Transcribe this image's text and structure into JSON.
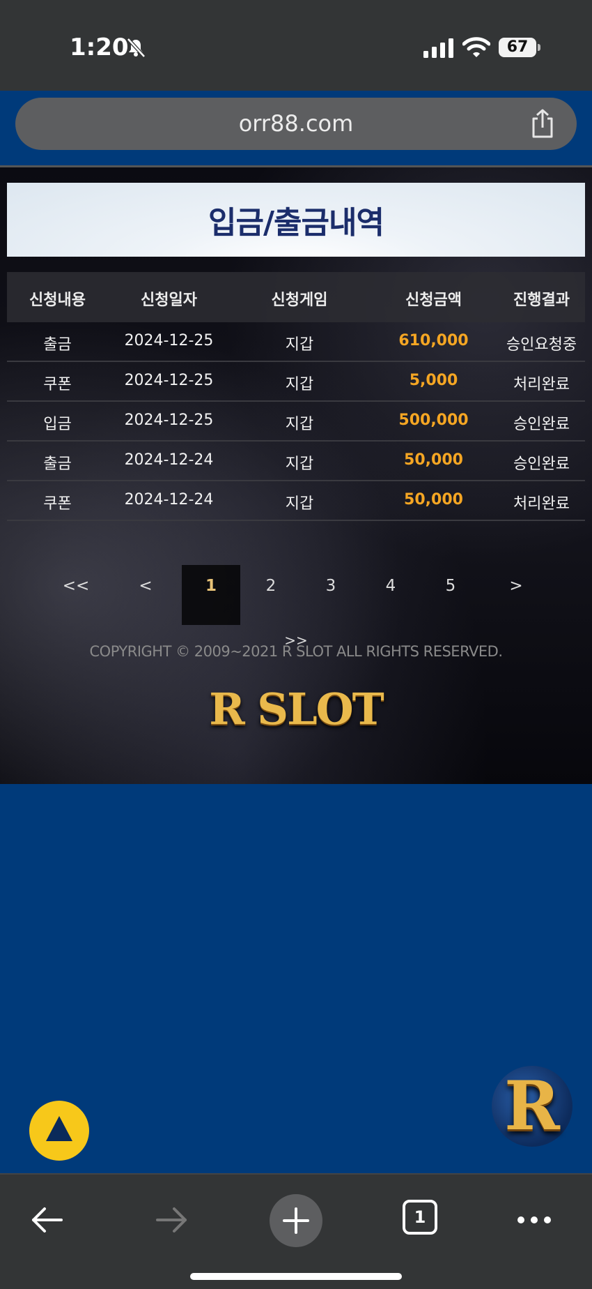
{
  "status_bar": {
    "time": "1:20",
    "battery": "67"
  },
  "browser": {
    "url": "orr88.com",
    "tabs_count": "1"
  },
  "page": {
    "title": "입금/출금내역",
    "table": {
      "headers": [
        "신청내용",
        "신청일자",
        "신청게임",
        "신청금액",
        "진행결과"
      ],
      "rows": [
        [
          "출금",
          "2024-12-25",
          "지갑",
          "610,000",
          "승인요청중"
        ],
        [
          "쿠폰",
          "2024-12-25",
          "지갑",
          "5,000",
          "처리완료"
        ],
        [
          "입금",
          "2024-12-25",
          "지갑",
          "500,000",
          "승인완료"
        ],
        [
          "출금",
          "2024-12-24",
          "지갑",
          "50,000",
          "승인완료"
        ],
        [
          "쿠폰",
          "2024-12-24",
          "지갑",
          "50,000",
          "처리완료"
        ]
      ]
    },
    "pagination": {
      "first": "<<",
      "prev": "<",
      "pages": [
        "1",
        "2",
        "3",
        "4",
        "5"
      ],
      "current": "1",
      "next": ">",
      "last": ">>"
    },
    "copyright": "COPYRIGHT © 2009~2021 R SLOT ALL RIGHTS RESERVED.",
    "logo": "R SLOT",
    "badge_letter": "R"
  },
  "colors": {
    "amount": "#f5a623",
    "title_text": "#1b2d6b",
    "body_background": "#003a7a",
    "scroll_top_button": "#f7c81a"
  }
}
